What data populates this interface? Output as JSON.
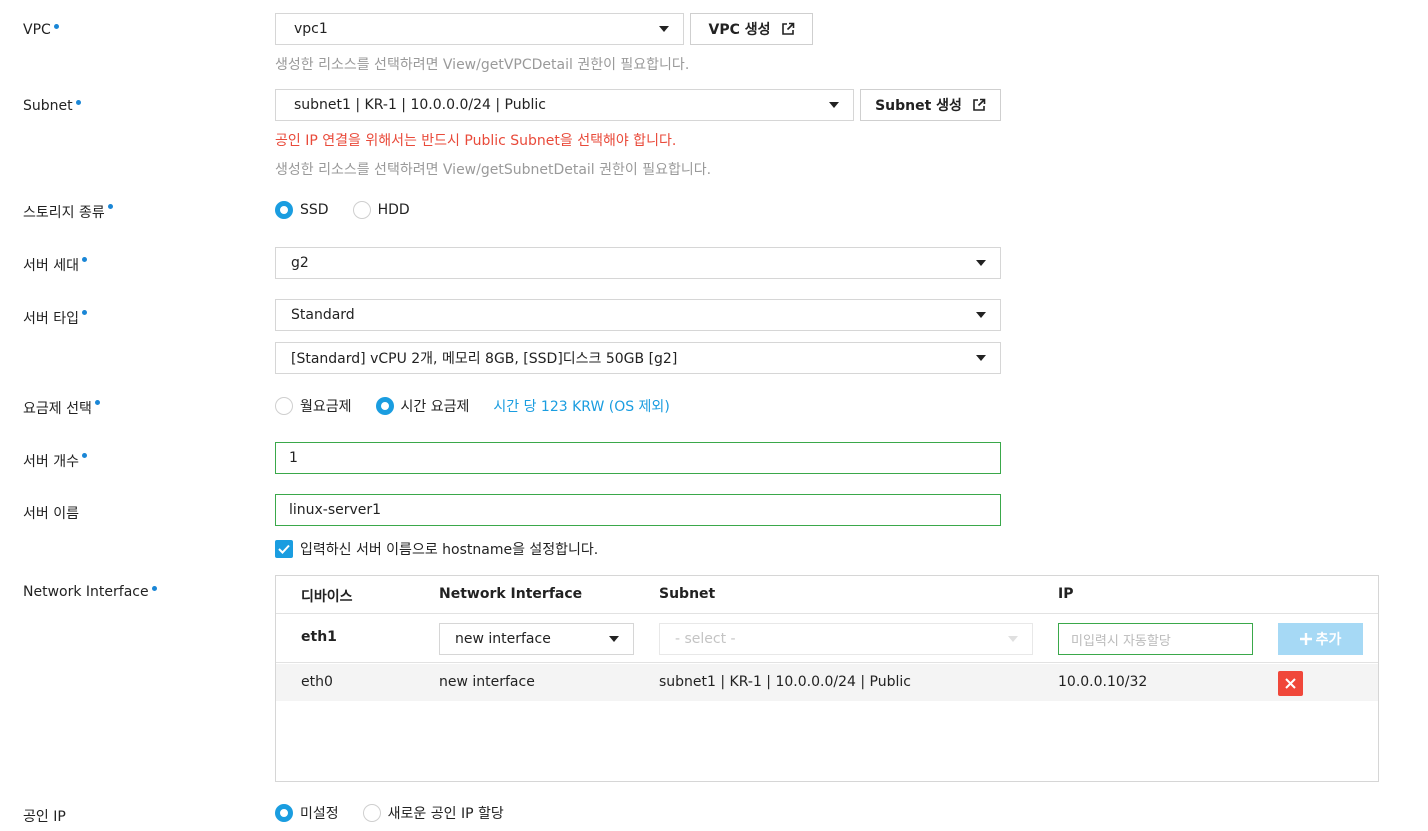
{
  "vpc": {
    "label": "VPC",
    "selected": "vpc1",
    "create_button": "VPC 생성",
    "hint": "생성한 리소스를 선택하려면 View/getVPCDetail 권한이 필요합니다."
  },
  "subnet": {
    "label": "Subnet",
    "selected": "subnet1 | KR-1 | 10.0.0.0/24 | Public",
    "create_button": "Subnet 생성",
    "warning": "공인 IP 연결을 위해서는 반드시 Public Subnet을 선택해야 합니다.",
    "hint": "생성한 리소스를 선택하려면 View/getSubnetDetail 권한이 필요합니다."
  },
  "storage": {
    "label": "스토리지 종류",
    "options": [
      "SSD",
      "HDD"
    ],
    "selected": "SSD"
  },
  "generation": {
    "label": "서버 세대",
    "selected": "g2"
  },
  "server_type": {
    "label": "서버 타입",
    "selected": "Standard",
    "spec_selected": "[Standard] vCPU 2개, 메모리 8GB, [SSD]디스크 50GB [g2]"
  },
  "pricing": {
    "label": "요금제 선택",
    "options": [
      "월요금제",
      "시간 요금제"
    ],
    "selected": "시간 요금제",
    "price_text": "시간 당 123 KRW (OS 제외)"
  },
  "server_count": {
    "label": "서버 개수",
    "value": "1"
  },
  "server_name": {
    "label": "서버 이름",
    "value": "linux-server1",
    "hostname_checkbox_label": "입력하신 서버 이름으로 hostname을 설정합니다.",
    "hostname_checked": true
  },
  "network_interface": {
    "label": "Network Interface",
    "columns": [
      "디바이스",
      "Network Interface",
      "Subnet",
      "IP"
    ],
    "edit_row": {
      "device": "eth1",
      "interface": "new interface",
      "subnet_placeholder": "- select -",
      "ip_placeholder": "미입력시 자동할당",
      "add_button": "추가"
    },
    "rows": [
      {
        "device": "eth0",
        "interface": "new interface",
        "subnet": "subnet1 | KR-1 | 10.0.0.0/24 | Public",
        "ip": "10.0.0.10/32"
      }
    ]
  },
  "public_ip": {
    "label": "공인 IP",
    "options": [
      "미설정",
      "새로운 공인 IP 할당"
    ],
    "selected": "미설정"
  },
  "colors": {
    "accent": "#1a9de0",
    "required_dot": "#1a86d6",
    "warning": "#e94a3a",
    "valid_border": "#3aa84a",
    "delete": "#f0473a"
  }
}
